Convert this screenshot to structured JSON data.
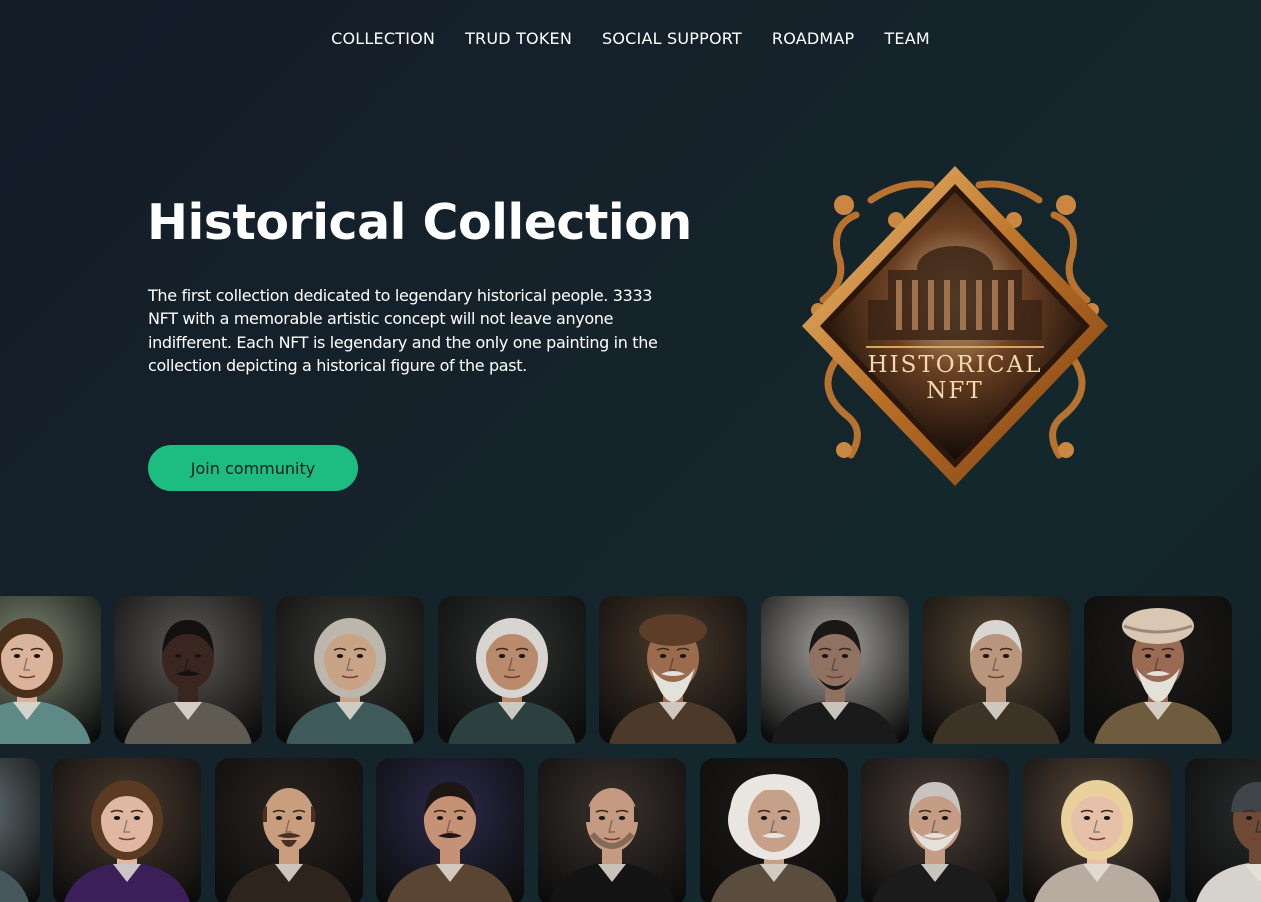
{
  "nav": {
    "items": [
      {
        "label": "COLLECTION",
        "name": "nav-collection"
      },
      {
        "label": "TRUD TOKEN",
        "name": "nav-trud-token"
      },
      {
        "label": "SOCIAL SUPPORT",
        "name": "nav-social-support"
      },
      {
        "label": "ROADMAP",
        "name": "nav-roadmap"
      },
      {
        "label": "TEAM",
        "name": "nav-team"
      }
    ]
  },
  "hero": {
    "title": "Historical Collection",
    "description": "The first collection dedicated to legendary historical people. 3333 NFT with a memorable artistic concept will not leave anyone indifferent. Each NFT is legendary and the only one painting in the collection depicting a historical figure of the past.",
    "cta_label": "Join community"
  },
  "logo": {
    "line1": "HISTORICAL",
    "line2": "NFT"
  },
  "colors": {
    "accent": "#1dbd82",
    "logo_gold": "#c8873a"
  },
  "gallery": {
    "row1": [
      {
        "name": "portrait-card-curly-hair-man",
        "bg": "#7f8a74",
        "skin": "#d9b39a",
        "hair": "#4a2e1c",
        "cloth": "#5d8a87",
        "beard": "",
        "hair_style": "curly"
      },
      {
        "name": "portrait-card-man-in-suit",
        "bg": "#5d5a55",
        "skin": "#3a2620",
        "hair": "#141010",
        "cloth": "#5f5a52",
        "beard": "mustache",
        "hair_style": "short"
      },
      {
        "name": "portrait-card-baroque-composer",
        "bg": "#3b3d36",
        "skin": "#c9a386",
        "hair": "#bdb6ac",
        "cloth": "#3e5a5a",
        "beard": "",
        "hair_style": "wig"
      },
      {
        "name": "portrait-card-elder-with-glasses",
        "bg": "#2e3330",
        "skin": "#b98a6c",
        "hair": "#d8d4cf",
        "cloth": "#2c4040",
        "beard": "",
        "hair_style": "long"
      },
      {
        "name": "portrait-card-bearded-elder-cap",
        "bg": "#4a3a2b",
        "skin": "#9c6b4e",
        "hair": "#5c3d28",
        "cloth": "#4b3a2a",
        "beard": "long-white",
        "hair_style": "cap"
      },
      {
        "name": "portrait-card-bearded-president",
        "bg": "#a8a7a2",
        "skin": "#8f7262",
        "hair": "#1a1716",
        "cloth": "#1b1a1a",
        "beard": "chin",
        "hair_style": "short"
      },
      {
        "name": "portrait-card-industrialist",
        "bg": "#5a4a36",
        "skin": "#b9957c",
        "hair": "#d9d6d2",
        "cloth": "#3d3226",
        "beard": "",
        "hair_style": "short"
      },
      {
        "name": "portrait-card-turban-elder",
        "bg": "#1e1c1a",
        "skin": "#9a6a52",
        "hair": "#d7cdc2",
        "cloth": "#6f5b3d",
        "beard": "long-white",
        "hair_style": "turban"
      }
    ],
    "row2": [
      {
        "name": "portrait-card-partial-left",
        "bg": "#6d7b80",
        "skin": "#c9a388",
        "hair": "#4a3c30",
        "cloth": "#46575c",
        "beard": "",
        "hair_style": "short"
      },
      {
        "name": "portrait-card-woman-fur",
        "bg": "#4b3b2e",
        "skin": "#e0b7a0",
        "hair": "#5b3a24",
        "cloth": "#3a1f59",
        "beard": "",
        "hair_style": "updo"
      },
      {
        "name": "portrait-card-elizabethan-writer",
        "bg": "#2b241f",
        "skin": "#c99e7f",
        "hair": "#4a3020",
        "cloth": "#2d241d",
        "beard": "goatee",
        "hair_style": "bald"
      },
      {
        "name": "portrait-card-inventor-lightning",
        "bg": "#2b2a4a",
        "skin": "#c69276",
        "hair": "#1e1612",
        "cloth": "#5a4433",
        "beard": "mustache",
        "hair_style": "short"
      },
      {
        "name": "portrait-card-tech-founder",
        "bg": "#3b332e",
        "skin": "#c49a80",
        "hair": "#2c2724",
        "cloth": "#141313",
        "beard": "stubble",
        "hair_style": "bald"
      },
      {
        "name": "portrait-card-physicist-wild-hair",
        "bg": "#1f1b18",
        "skin": "#c7a08a",
        "hair": "#e9e6e1",
        "cloth": "#5a4d3e",
        "beard": "mustache",
        "hair_style": "wild"
      },
      {
        "name": "portrait-card-scientist-gray-beard",
        "bg": "#4c4038",
        "skin": "#c49d84",
        "hair": "#c8c3bf",
        "cloth": "#1c1b1b",
        "beard": "full-gray",
        "hair_style": "short"
      },
      {
        "name": "portrait-card-blonde-actress",
        "bg": "#5c4a3c",
        "skin": "#e6c0a8",
        "hair": "#ead09b",
        "cloth": "#b8aca0",
        "beard": "",
        "hair_style": "curly"
      },
      {
        "name": "portrait-card-bandana-rapper",
        "bg": "#2a2b2c",
        "skin": "#6e4a36",
        "hair": "#3f4548",
        "cloth": "#d6d3cf",
        "beard": "",
        "hair_style": "bandana"
      }
    ]
  }
}
